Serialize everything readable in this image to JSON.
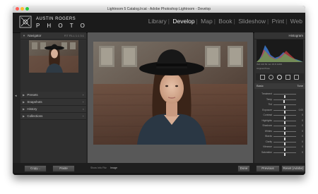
{
  "window": {
    "title": "Lightroom 5 Catalog.lrcat - Adobe Photoshop Lightroom - Develop",
    "traffic_colors": [
      "#ff5f57",
      "#febc2e",
      "#28c840"
    ]
  },
  "identity_plate": {
    "line1": "AUSTIN ROGERS",
    "line2": "P H O T O"
  },
  "modules": [
    "Library",
    "Develop",
    "Map",
    "Book",
    "Slideshow",
    "Print",
    "Web"
  ],
  "active_module": "Develop",
  "left_panel": {
    "navigator": {
      "label": "Navigator",
      "zoom_options": "FIT  FILL  1:1  3:1"
    },
    "sections": [
      {
        "label": "Presets"
      },
      {
        "label": "Snapshots"
      },
      {
        "label": "History"
      },
      {
        "label": "Collections"
      }
    ]
  },
  "right_panel": {
    "histogram_label": "Histogram",
    "histogram_readout": "ISO 100   50 mm   f/2.8   1/200",
    "original_photo_label": "Original Photo",
    "basic_tab": {
      "label": "Basic",
      "tone_label": "Tone"
    },
    "color_label": "Color",
    "sliders": [
      {
        "label": "Treatment",
        "value": "",
        "position": 0.5
      },
      {
        "label": "Temp",
        "value": "",
        "position": 0.45
      },
      {
        "label": "Tint",
        "value": "",
        "position": 0.5
      },
      {
        "label": "Exposure",
        "value": "0.00",
        "position": 0.5
      },
      {
        "label": "Contrast",
        "value": "0",
        "position": 0.5
      },
      {
        "label": "Highlights",
        "value": "0",
        "position": 0.5
      },
      {
        "label": "Shadows",
        "value": "0",
        "position": 0.5
      },
      {
        "label": "Whites",
        "value": "0",
        "position": 0.5
      },
      {
        "label": "Blacks",
        "value": "0",
        "position": 0.5
      },
      {
        "label": "Clarity",
        "value": "0",
        "position": 0.5
      },
      {
        "label": "Vibrance",
        "value": "0",
        "position": 0.5
      },
      {
        "label": "Saturation",
        "value": "0",
        "position": 0.5
      }
    ]
  },
  "bottom_bar": {
    "copy_label": "Copy...",
    "paste_label": "Paste",
    "soft_proof_label": "Show Info Fitz",
    "soft_proof_value": "Image",
    "done_label": "Done",
    "previous_label": "Previous",
    "reset_label": "Reset (Adobe)"
  },
  "colors": {
    "panel_bg": "#2f2f2f",
    "workspace_bg": "#585858",
    "active_module": "#f0f0f0",
    "inactive_module": "#8a8a8a"
  }
}
